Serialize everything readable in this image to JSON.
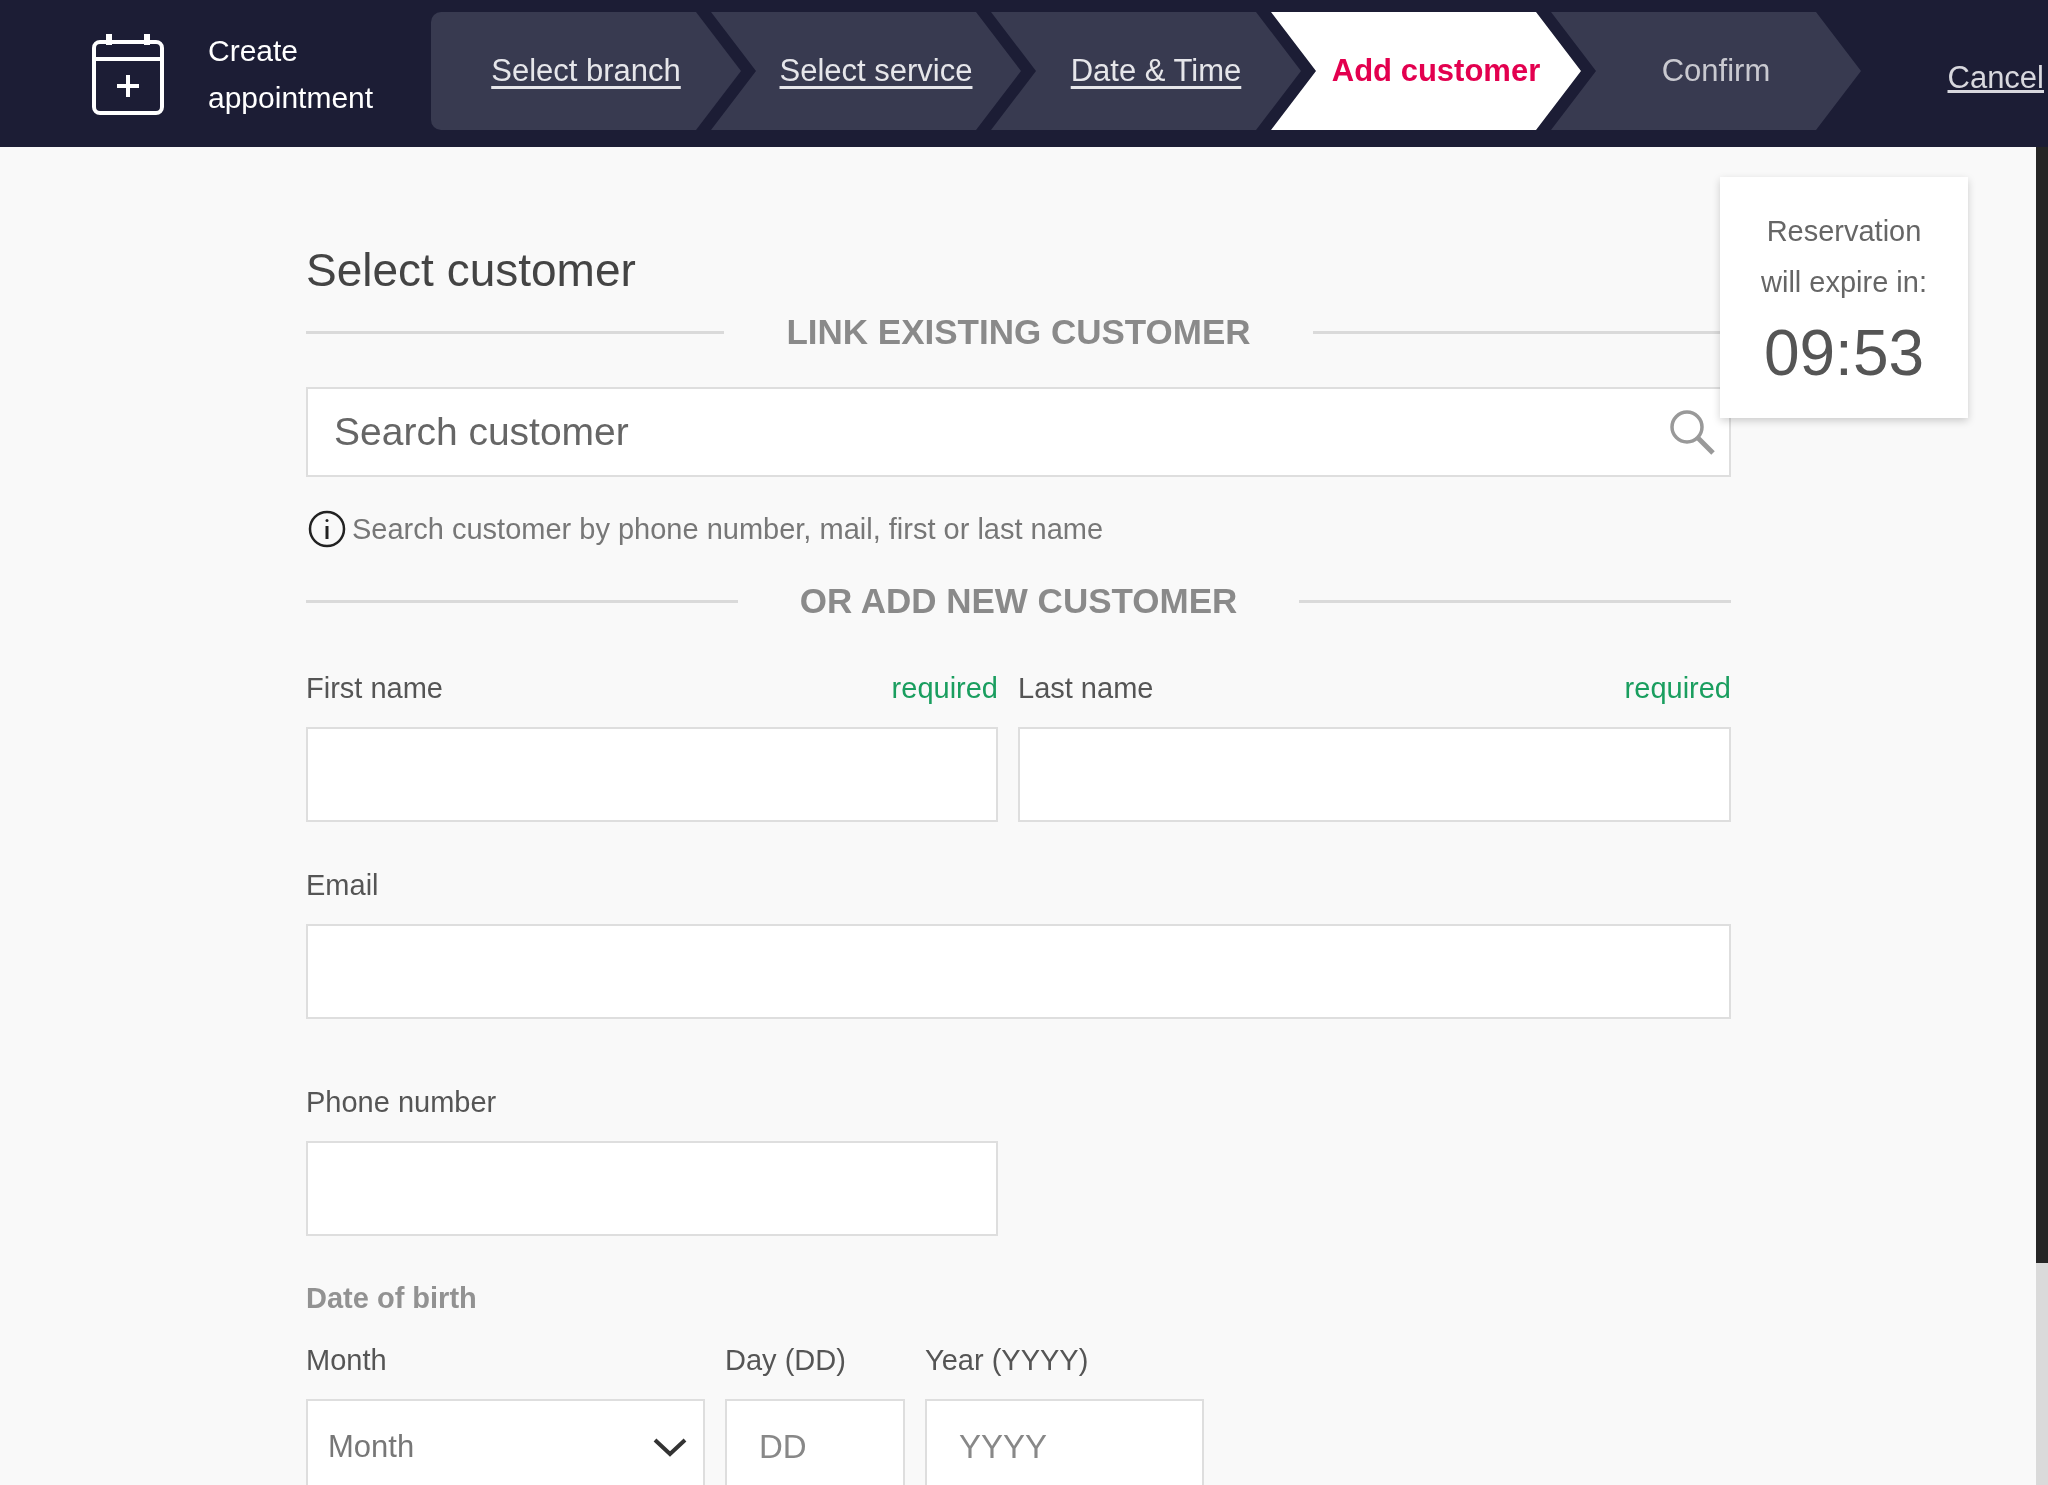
{
  "header": {
    "title": "Create appointment",
    "steps": [
      {
        "label": "Select branch",
        "completed": true,
        "selected": false
      },
      {
        "label": "Select service",
        "completed": true,
        "selected": false
      },
      {
        "label": "Date & Time",
        "completed": true,
        "selected": false
      },
      {
        "label": "Add customer",
        "completed": false,
        "selected": true
      },
      {
        "label": "Confirm",
        "completed": false,
        "selected": false
      }
    ],
    "cancel": "Cancel"
  },
  "page_title": "Select customer",
  "link_section": {
    "heading": "LINK EXISTING CUSTOMER",
    "search": {
      "placeholder": "Search customer"
    },
    "hint": "Search customer by phone number, mail, first or last name"
  },
  "new_section": {
    "heading": "OR ADD NEW CUSTOMER",
    "fields": [
      {
        "kind": "half",
        "label": "First name",
        "required": "required"
      },
      {
        "kind": "half",
        "label": "Last name",
        "required": "required"
      },
      {
        "kind": "full",
        "label": "Email"
      },
      {
        "kind": "half",
        "label": "Phone number"
      }
    ]
  },
  "date_of_birth": {
    "heading": "Date of birth",
    "month": {
      "label": "Month",
      "placeholder": "Month"
    },
    "day": {
      "label": "Day (DD)",
      "placeholder": "DD"
    },
    "year": {
      "label": "Year (YYYY)",
      "placeholder": "YYYY"
    }
  },
  "timer": {
    "label": "Reservation will expire in:",
    "time": "09:53"
  }
}
